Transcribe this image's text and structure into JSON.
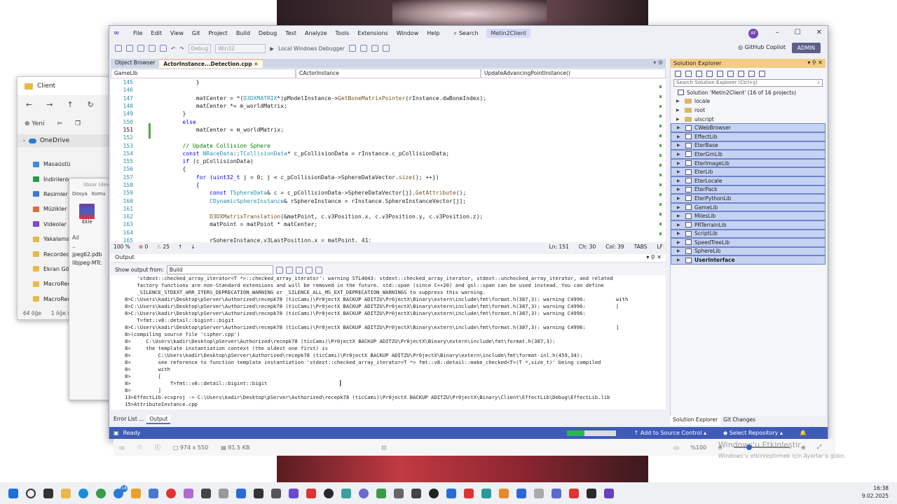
{
  "explorer": {
    "title": "Client",
    "new_label": "Yeni",
    "onedrive": "OneDrive",
    "items": [
      "Masaüstü",
      "İndirilenler",
      "Resimler",
      "Müzikler",
      "Videolar",
      "Yakalamala",
      "Recorded",
      "Ekran Görü",
      "MacroReco",
      "MacroReco"
    ],
    "status": [
      "64 öğe",
      "1 öğe se"
    ]
  },
  "winrar": {
    "title": "libzar (dev",
    "menu": [
      "Dosya",
      "Komu"
    ],
    "add": "Ekle",
    "col": "Ad",
    "rows": [
      "..",
      "jpeg62.pdb",
      "libjpeg-MTc"
    ]
  },
  "vs": {
    "menus": [
      "File",
      "Edit",
      "View",
      "Git",
      "Project",
      "Build",
      "Debug",
      "Test",
      "Analyze",
      "Tools",
      "Extensions",
      "Window",
      "Help"
    ],
    "search": "Search",
    "solution_name": "Metin2Client",
    "avatar": "AF",
    "toolbar": {
      "config": "Debug",
      "platform": "Win32",
      "debugger": "Local Windows Debugger",
      "copilot": "GitHub Copilot",
      "admin": "ADMIN"
    },
    "doc_tabs": [
      "Object Browser",
      "ActorInstance...Detection.cpp"
    ],
    "nav": [
      "GameLib",
      "CActorInstance",
      "UpdateAdvancingPointInstance()"
    ],
    "code_lines": [
      {
        "no": "145",
        "t": "            }"
      },
      {
        "no": "146",
        "t": ""
      },
      {
        "no": "147",
        "t": "            matCenter = *(D3DXMATRIX*)pModelInstance->GetBoneMatrixPointer(rInstance.dwBoneIndex);"
      },
      {
        "no": "148",
        "t": "            matCenter *= m_worldMatrix;"
      },
      {
        "no": "149",
        "t": "        }"
      },
      {
        "no": "150",
        "t": "        else"
      },
      {
        "no": "151",
        "t": "            matCenter = m_worldMatrix;"
      },
      {
        "no": "152",
        "t": ""
      },
      {
        "no": "153",
        "t": "        // Update Collision Sphere"
      },
      {
        "no": "154",
        "t": "        const NRaceData::TCollisionData* c_pCollisionData = rInstance.c_pCollisionData;"
      },
      {
        "no": "155",
        "t": "        if (c_pCollisionData)"
      },
      {
        "no": "156",
        "t": "        {"
      },
      {
        "no": "157",
        "t": "            for (uint32_t j = 0; j < c_pCollisionData->SphereDataVector.size(); ++j)"
      },
      {
        "no": "158",
        "t": "            {"
      },
      {
        "no": "159",
        "t": "                const TSphereData& c = c_pCollisionData->SphereDataVector[j].GetAttribute();"
      },
      {
        "no": "160",
        "t": "                CDynamicSphereInstance& rSphereInstance = rInstance.SphereInstanceVector[j];"
      },
      {
        "no": "161",
        "t": ""
      },
      {
        "no": "162",
        "t": "                D3DXMatrixTranslation(&matPoint, c.v3Position.x, c.v3Position.y, c.v3Position.z);"
      },
      {
        "no": "163",
        "t": "                matPoint = matPoint * matCenter;"
      },
      {
        "no": "164",
        "t": ""
      },
      {
        "no": "165",
        "t": "                rSphereInstance.v3LastPosition.x = matPoint._41;"
      }
    ],
    "editor_status": {
      "zoom": "100 %",
      "errors": "0",
      "warnings": "25",
      "ln": "Ln: 151",
      "ch": "Ch: 30",
      "col": "Col: 39",
      "tabs": "TABS",
      "eol": "LF"
    },
    "output": {
      "title": "Output",
      "show_from": "Show output from:",
      "source": "Build",
      "lines": [
        "    'stdext::checked_array_iterator<T *>::checked_array_iterator': warning STL4043: stdext::checked_array_iterator, stdext::unchecked_array_iterator, and related",
        "    factory functions are non-Standard extensions and will be removed in the future. std::span (since C++20) and gsl::span can be used instead. You can define",
        "    _SILENCE_STDEXT_ARR_ITERS_DEPRECATION_WARNING or _SILENCE_ALL_MS_EXT_DEPRECATION_WARNINGS to suppress this warning.",
        "8>C:\\Users\\kadir\\Desktop\\pServer\\Authorized\\recepk78 (ticCamı)\\Pr0jectX BACKUP ADITZU\\Pr0jectX\\Binary\\extern\\include\\fmt\\format.h(387,3): warning C4996:          with",
        "8>C:\\Users\\kadir\\Desktop\\pServer\\Authorized\\recepk78 (ticCamı)\\Pr0jectX BACKUP ADITZU\\Pr0jectX\\Binary\\extern\\include\\fmt\\format.h(387,3): warning C4996:          [",
        "8>C:\\Users\\kadir\\Desktop\\pServer\\Authorized\\recepk78 (ticCamı)\\Pr0jectX BACKUP ADITZU\\Pr0jectX\\Binary\\extern\\include\\fmt\\format.h(387,3): warning C4996:",
        "    T=fmt::v8::detail::bigint::bigit",
        "8>C:\\Users\\kadir\\Desktop\\pServer\\Authorized\\recepk78 (ticCamı)\\Pr0jectX BACKUP ADITZU\\Pr0jectX\\Binary\\extern\\include\\fmt\\format.h(387,3): warning C4996:          ]",
        "8>(compiling source file 'cipher.cpp')",
        "8>     C:\\Users\\kadir\\Desktop\\pServer\\Authorized\\recepk78 (ticCamı)\\Pr0jectX BACKUP ADITZU\\Pr0jectX\\Binary\\extern\\include\\fmt\\format.h(387,3):",
        "8>     the template instantiation context (the oldest one first) is",
        "8>         C:\\Users\\kadir\\Desktop\\pServer\\Authorized\\recepk78 (ticCamı)\\Pr0jectX BACKUP ADITZU\\Pr0jectX\\Binary\\extern\\include\\fmt\\format-inl.h(459,34):",
        "8>         see reference to function template instantiation 'stdext::checked_array_iterator<T *> fmt::v8::detail::make_checked<T>(T *,size_t)' being compiled",
        "8>         with",
        "8>         [",
        "8>             T=fmt::v8::detail::bigint::bigit",
        "8>         ]",
        "13>EffectLib.vcxproj -> C:\\Users\\kadir\\Desktop\\pServer\\Authorized\\recepk78 (ticCamı)\\Pr0jectX BACKUP ADITZU\\Pr0jectX\\Binary\\Client\\EffectLib\\Debug\\EffectLib.lib",
        "15>AttributeInstance.cpp"
      ]
    },
    "bottom_tabs": [
      "Error List ...",
      "Output"
    ],
    "solution_explorer": {
      "title": "Solution Explorer",
      "search_placeholder": "Search Solution Explorer (Ctrl+ş)",
      "solution": "Solution 'Metin2Client' (16 of 16 projects)",
      "folders": [
        "locale",
        "root",
        "uiscript"
      ],
      "projects": [
        "CWebBrowser",
        "EffectLib",
        "EterBase",
        "EterGrnLib",
        "EterImageLib",
        "EterLib",
        "EterLocale",
        "EterPack",
        "EterPythonLib",
        "GameLib",
        "MilesLib",
        "PRTerrainLib",
        "ScriptLib",
        "SpeedTreeLib",
        "SphereLib",
        "UserInterface"
      ],
      "tabs": [
        "Solution Explorer",
        "Git Changes"
      ]
    },
    "status": {
      "ready": "Ready",
      "source_control": "Add to Source Control",
      "repo": "Select Repository"
    }
  },
  "viewer": {
    "dims": "974 x 550",
    "size": "81.5 KB",
    "zoom": "%100"
  },
  "watermark": {
    "line1": "Windows'u Etkinleştir",
    "line2": "Windows'u etkinleştirmek için Ayarlar'a gidin."
  },
  "clock": {
    "time": "16:38",
    "date": "9.02.2025"
  },
  "taskbar_badge": "18"
}
